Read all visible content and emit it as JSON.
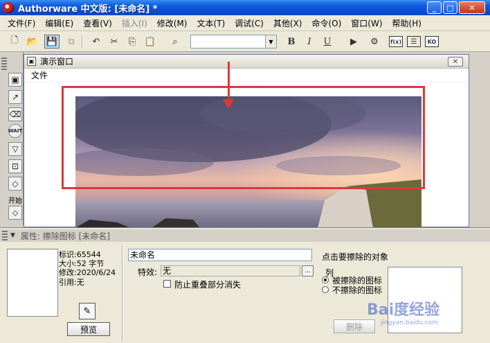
{
  "window": {
    "title": "Authorware 中文版: [未命名] *",
    "min": "_",
    "max": "□",
    "close": "✕"
  },
  "menu": [
    "文件(F)",
    "编辑(E)",
    "查看(V)",
    "插入(I)",
    "修改(M)",
    "文本(T)",
    "调试(C)",
    "其他(X)",
    "命令(O)",
    "窗口(W)",
    "帮助(H)"
  ],
  "toolbar": {
    "bold": "B",
    "italic": "I",
    "underline": "U",
    "fx_label": "f(x)",
    "ko_label": "KO",
    "font_combo_value": ""
  },
  "palette": {
    "label": "开始"
  },
  "presentation": {
    "title": "演示窗口",
    "menu": "文件",
    "close": "✕"
  },
  "properties": {
    "header": "属性: 擦除图标 [未命名]",
    "id_line": "标识:65544",
    "size_line": "大小:52 字节",
    "modified_line": "修改:2020/6/24",
    "ref_line": "引用:无",
    "preview_button": "预览",
    "name_value": "未命名",
    "effect_label": "特效:",
    "effect_value": "无",
    "effect_button": "...",
    "prevent_overlap_label": "防止重叠部分消失",
    "hint": "点击要擦除的对象",
    "list_label": "列",
    "radio_erase": "被擦除的图标",
    "radio_keep": "不擦除的图标",
    "delete_button": "删除"
  },
  "watermark": {
    "text": "Bai度经验",
    "sub": "jingyan.baidu.com"
  },
  "colors": {
    "highlight_red": "#e0363a",
    "titlebar_blue": "#0a5fe0"
  }
}
